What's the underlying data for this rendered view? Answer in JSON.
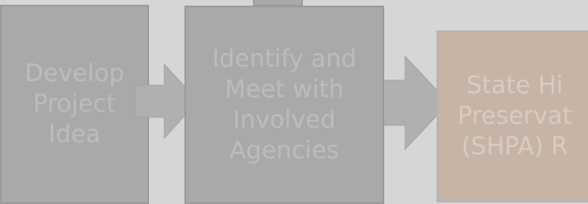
{
  "diagram": {
    "steps": [
      {
        "label": "Develop\nProject\nIdea"
      },
      {
        "label": "Identify and\nMeet with\nInvolved\nAgencies"
      },
      {
        "label": "State Hi\nPreservat\n(SHPA) R"
      }
    ],
    "colors": {
      "background": "#d6d6d6",
      "box": "#a9a9a9",
      "box_highlight": "#c6b4a7",
      "arrow": "#b0b0b0",
      "text": "#bcbcbc"
    }
  }
}
